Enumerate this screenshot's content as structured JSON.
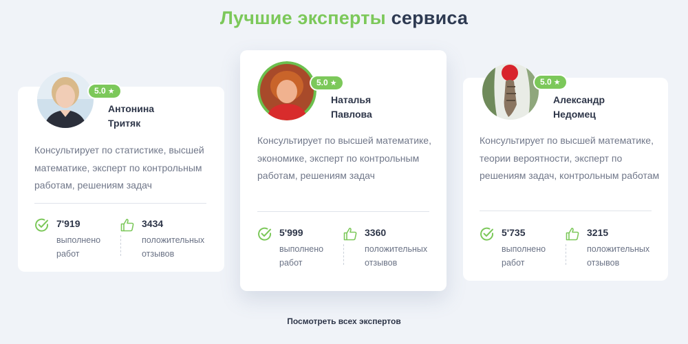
{
  "heading": {
    "accent": "Лучшие эксперты",
    "rest": "сервиса"
  },
  "colors": {
    "accent": "#7cc85a",
    "text_dark": "#2d3548",
    "text_muted": "#707789",
    "background": "#f0f3f8"
  },
  "experts": [
    {
      "rating": "5.0",
      "first_name": "Антонина",
      "last_name": "Тритяк",
      "description": "Консультирует по статистике, высшей математике, эксперт по контрольным работам, решениям задач",
      "completed_count": "7'919",
      "completed_label_1": "выполнено",
      "completed_label_2": "работ",
      "reviews_count": "3434",
      "reviews_label_1": "положительных",
      "reviews_label_2": "отзывов"
    },
    {
      "rating": "5.0",
      "first_name": "Наталья",
      "last_name": "Павлова",
      "description": "Консультирует по высшей математике, экономике, эксперт по контрольным работам, решениям задач",
      "completed_count": "5'999",
      "completed_label_1": "выполнено",
      "completed_label_2": "работ",
      "reviews_count": "3360",
      "reviews_label_1": "положительных",
      "reviews_label_2": "отзывов"
    },
    {
      "rating": "5.0",
      "first_name": "Александр",
      "last_name": "Недомец",
      "description": "Консультирует по высшей математике, теории вероятности, эксперт по решениям задач, контрольным работам",
      "completed_count": "5'735",
      "completed_label_1": "выполнено",
      "completed_label_2": "работ",
      "reviews_count": "3215",
      "reviews_label_1": "положительных",
      "reviews_label_2": "отзывов"
    }
  ],
  "icons": {
    "rating": "star-icon",
    "completed": "check-circle-icon",
    "reviews": "thumbs-up-icon"
  },
  "footer": {
    "all_experts_link": "Посмотреть всех экспертов"
  }
}
